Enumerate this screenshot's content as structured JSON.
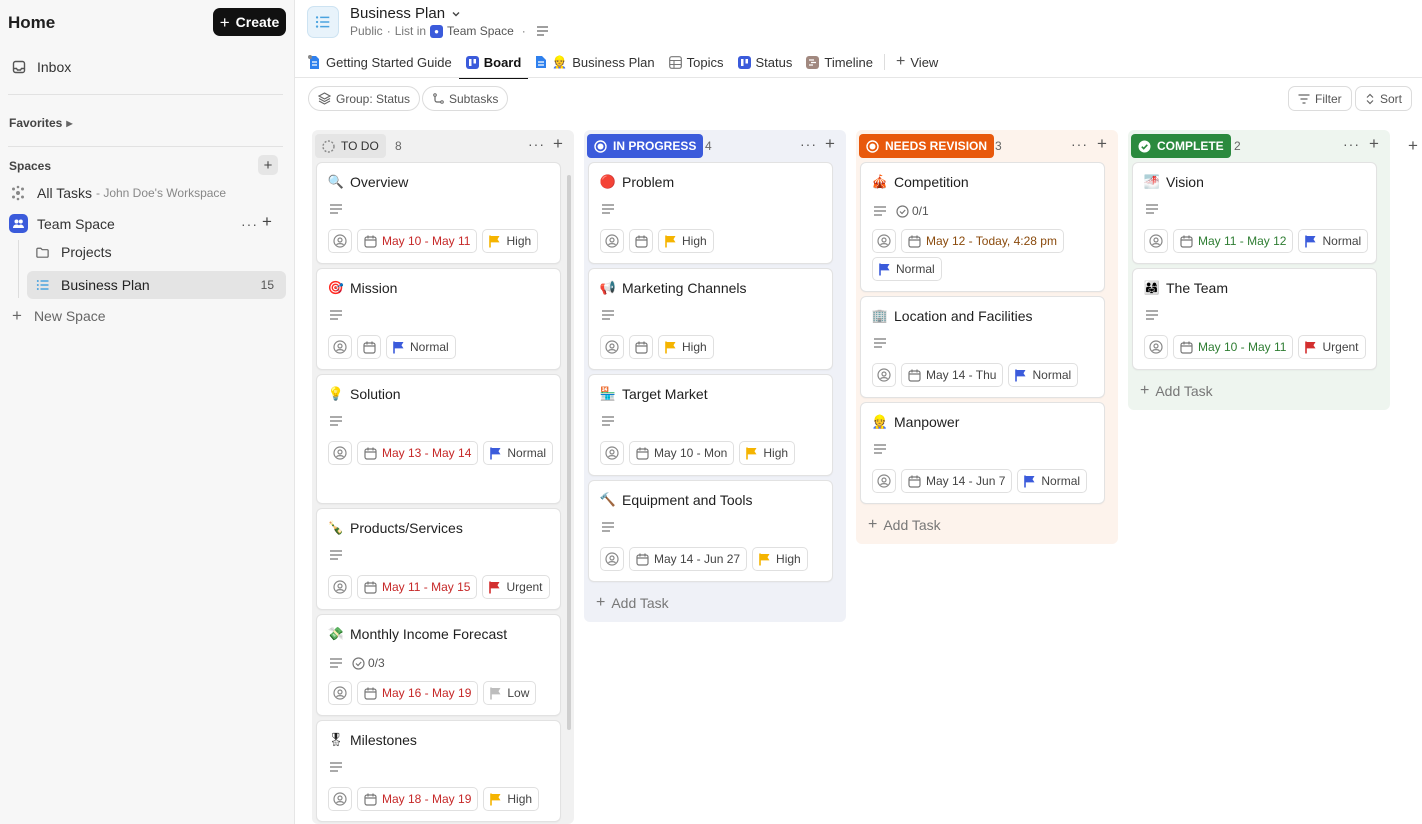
{
  "sidebar": {
    "home": "Home",
    "create": "Create",
    "inbox": "Inbox",
    "favorites": "Favorites",
    "spaces": "Spaces",
    "all_tasks": "All Tasks",
    "workspace": "- John Doe's Workspace",
    "team_space": "Team Space",
    "projects": "Projects",
    "business_plan": "Business Plan",
    "business_plan_count": "15",
    "new_space": "New Space"
  },
  "header": {
    "title": "Business Plan",
    "visibility": "Public",
    "list_in": "List in",
    "space": "Team Space"
  },
  "views": [
    {
      "label": "Getting Started Guide"
    },
    {
      "label": "Board"
    },
    {
      "label": "Business Plan"
    },
    {
      "label": "Topics"
    },
    {
      "label": "Status"
    },
    {
      "label": "Timeline"
    },
    {
      "label": "View"
    }
  ],
  "toolbar": {
    "group": "Group: Status",
    "subtasks": "Subtasks",
    "filter": "Filter",
    "sort": "Sort"
  },
  "columns": [
    {
      "status": "TO DO",
      "count": "8",
      "color": "#e9e9e9",
      "cards": [
        {
          "title": "Overview",
          "emoji": "🔍",
          "date": "May 10 - May 11",
          "priority": "High"
        },
        {
          "title": "Mission",
          "emoji": "🎯",
          "priority": "Normal"
        },
        {
          "title": "Solution",
          "emoji": "💡",
          "date": "May 13 - May 14",
          "priority": "Normal"
        },
        {
          "title": "Products/Services",
          "emoji": "🍾",
          "date": "May 11 - May 15",
          "priority": "Urgent"
        },
        {
          "title": "Monthly Income Forecast",
          "emoji": "💸",
          "checklist": "0/3",
          "date": "May 16 - May 19",
          "priority": "Low"
        },
        {
          "title": "Milestones",
          "emoji": "🎖",
          "date": "May 18 - May 19",
          "priority": "High"
        }
      ]
    },
    {
      "status": "IN PROGRESS",
      "count": "4",
      "color": "#3b5bdb",
      "cards": [
        {
          "title": "Problem",
          "emoji": "🔴",
          "priority": "High"
        },
        {
          "title": "Marketing Channels",
          "emoji": "📢",
          "priority": "High"
        },
        {
          "title": "Target Market",
          "emoji": "🏪",
          "date": "May 10 - Mon",
          "priority": "High"
        },
        {
          "title": "Equipment and Tools",
          "emoji": "🔨",
          "date": "May 14 - Jun 27",
          "priority": "High"
        }
      ],
      "add": "Add Task"
    },
    {
      "status": "NEEDS REVISION",
      "count": "3",
      "color": "#e8590c",
      "cards": [
        {
          "title": "Competition",
          "emoji": "🎪",
          "checklist": "0/1",
          "date": "May 12 - Today, 4:28 pm",
          "priority": "Normal"
        },
        {
          "title": "Location and Facilities",
          "emoji": "🏢",
          "date": "May 14 - Thu",
          "priority": "Normal"
        },
        {
          "title": "Manpower",
          "emoji": "👷",
          "date": "May 14 - Jun 7",
          "priority": "Normal"
        }
      ],
      "add": "Add Task"
    },
    {
      "status": "COMPLETE",
      "count": "2",
      "color": "#2b8a3e",
      "cards": [
        {
          "title": "Vision",
          "emoji": "🌁",
          "date": "May 11 - May 12",
          "priority": "Normal"
        },
        {
          "title": "The Team",
          "emoji": "👨‍👩‍👧",
          "date": "May 10 - May 11",
          "priority": "Urgent"
        }
      ],
      "add": "Add Task"
    }
  ],
  "colors": {
    "high": "#f5b400",
    "normal": "#3b5bdb",
    "urgent": "#d32f2f",
    "low": "#bdbdbd"
  }
}
